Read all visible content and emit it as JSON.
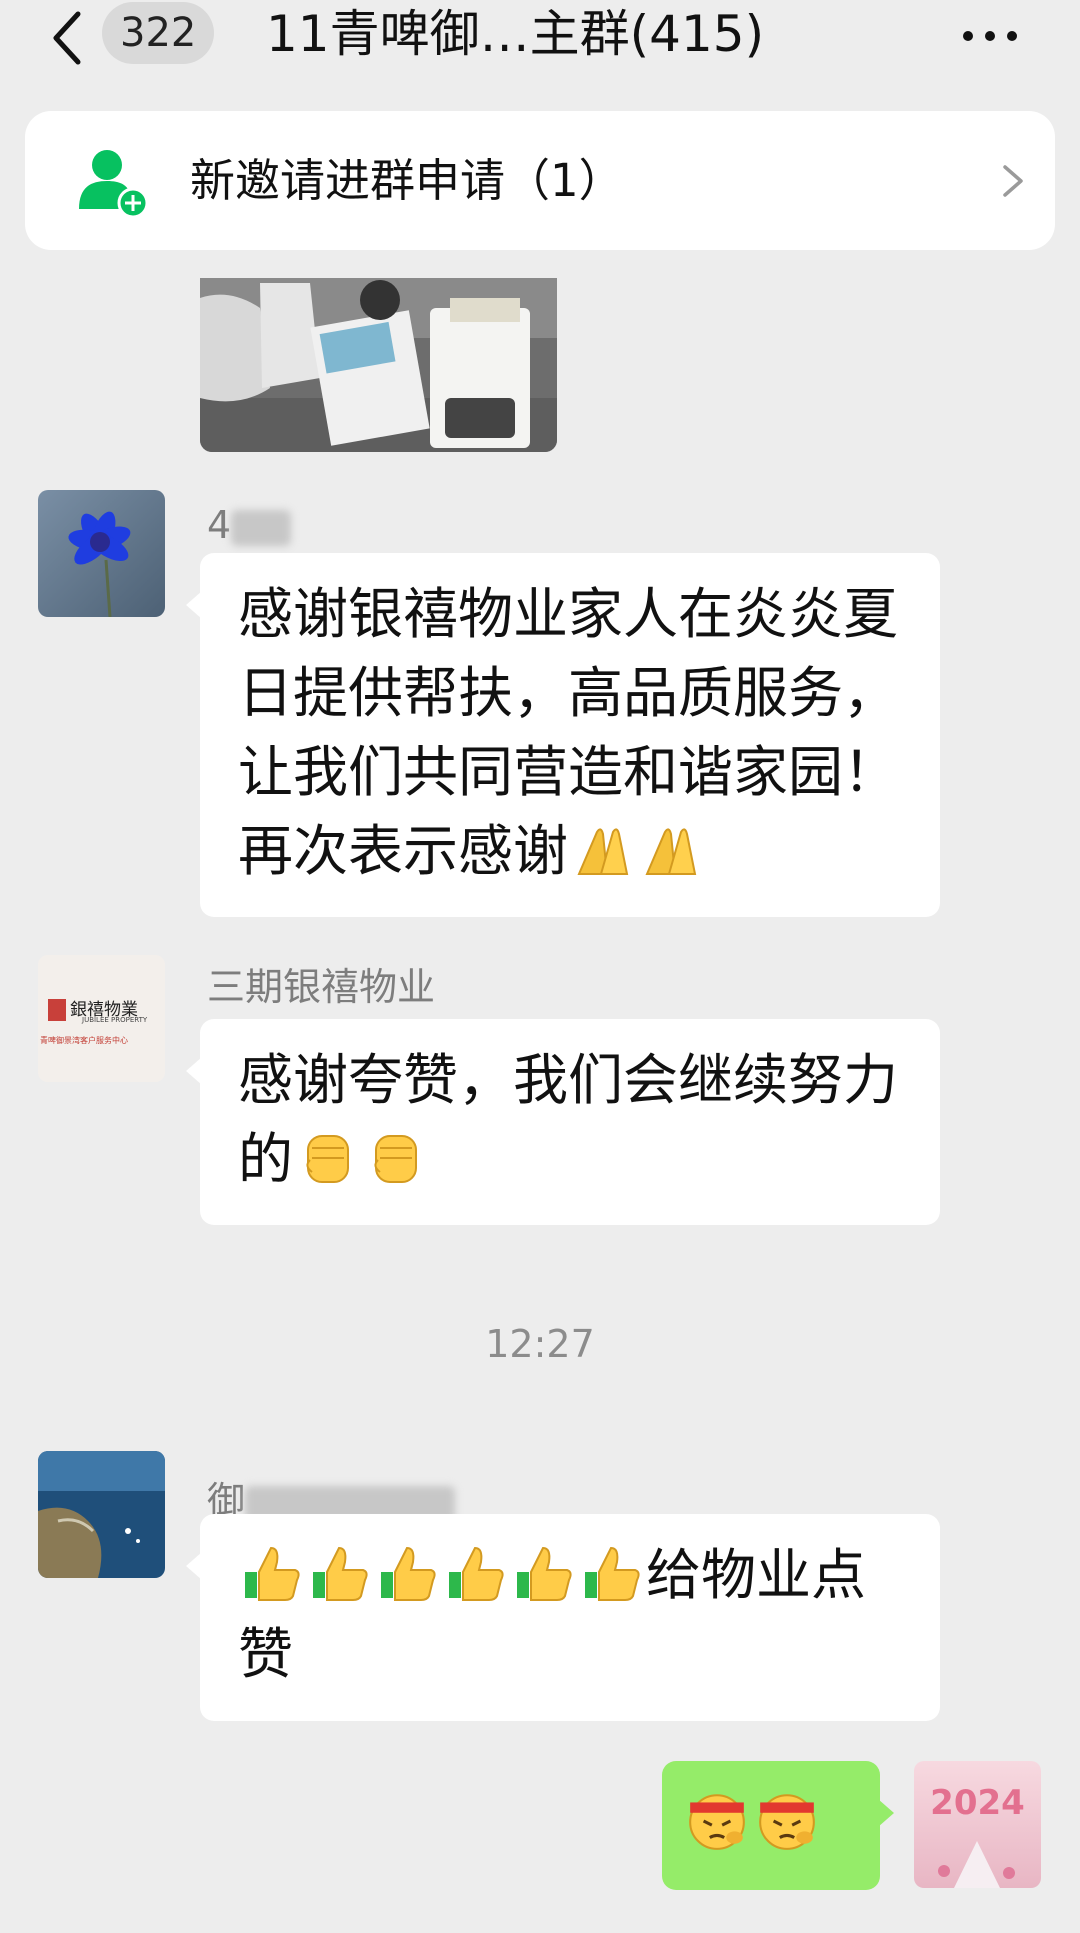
{
  "header": {
    "unread_count": "322",
    "title": "11青啤御…主群(415)"
  },
  "banner": {
    "text": "新邀请进群申请（1）"
  },
  "messages": [
    {
      "sender": "4",
      "text_parts": [
        "感谢银禧物业家人在炎炎夏日提供帮扶，高品质服务，让我们共同营造和谐家园！再次表示感谢"
      ],
      "emoji": [
        "folded-hands",
        "folded-hands"
      ]
    },
    {
      "sender": "三期银禧物业",
      "text_parts": [
        "感谢夸赞，我们会继续努力的"
      ],
      "emoji": [
        "raised-fist",
        "raised-fist"
      ],
      "avatar_logo": {
        "line1": "銀禧物業",
        "line2": "JUBILEE PROPERTY",
        "line3": "青啤御景湾客户服务中心"
      }
    },
    {
      "sender": "御",
      "text_after_emoji": "给物业点赞",
      "emoji": [
        "thumbs-up",
        "thumbs-up",
        "thumbs-up",
        "thumbs-up",
        "thumbs-up",
        "thumbs-up"
      ]
    },
    {
      "self": true,
      "emoji": [
        "headband-face",
        "headband-face"
      ],
      "avatar_text": "2024"
    }
  ],
  "timestamp": "12:27",
  "colors": {
    "background": "#ededed",
    "bubble_incoming": "#ffffff",
    "bubble_outgoing": "#95ec69",
    "accent_green": "#07c160"
  }
}
